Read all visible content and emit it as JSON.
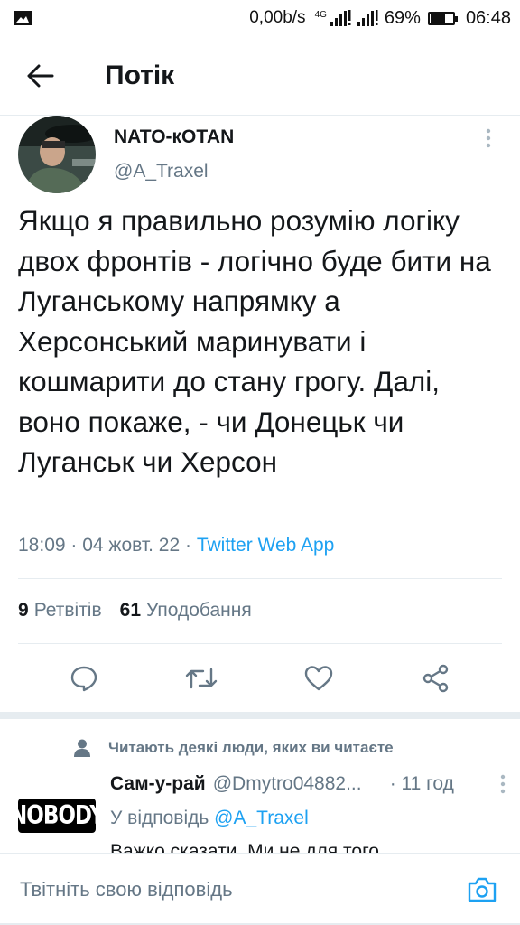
{
  "status_bar": {
    "network_speed": "0,00b/s",
    "network_type": "4G",
    "battery_percent": "69%",
    "battery_level": 0.69,
    "time": "06:48"
  },
  "header": {
    "title": "Потік",
    "back_icon": "arrow-left-icon"
  },
  "tweet": {
    "author_name": "NATO-кОТАN",
    "author_handle": "@A_Traxel",
    "text": "Якщо я правильно розумію логіку двох фронтів - логічно буде бити на Луганському напрямку а Херсонський маринувати і кошмарити до стану грогу. Далі, воно покаже, - чи Донецьк чи Луганськ чи Херсон",
    "time": "18:09",
    "date": "04 жовт. 22",
    "separator": " · ",
    "source": "Twitter Web App",
    "retweets_count": "9",
    "retweets_label": "Ретвітів",
    "likes_count": "61",
    "likes_label": "Уподобання",
    "actions": [
      "reply-icon",
      "retweet-icon",
      "like-icon",
      "share-icon"
    ]
  },
  "reply": {
    "social_context": "Читають деякі люди, яких ви читаєте",
    "avatar_text": "NOBODY",
    "name": "Сам-у-рай",
    "handle": "@Dmytro04882...",
    "time": "· 11 год",
    "replying_to_label": "У відповідь",
    "replying_to_handle": "@A_Traxel",
    "text": "Важко сказати. Ми не для того"
  },
  "compose": {
    "placeholder": "Твітніть свою відповідь",
    "camera_icon": "camera-icon"
  },
  "colors": {
    "accent": "#1da1f2",
    "text": "#14171a",
    "secondary": "#657786",
    "divider": "#e6ecf0"
  }
}
